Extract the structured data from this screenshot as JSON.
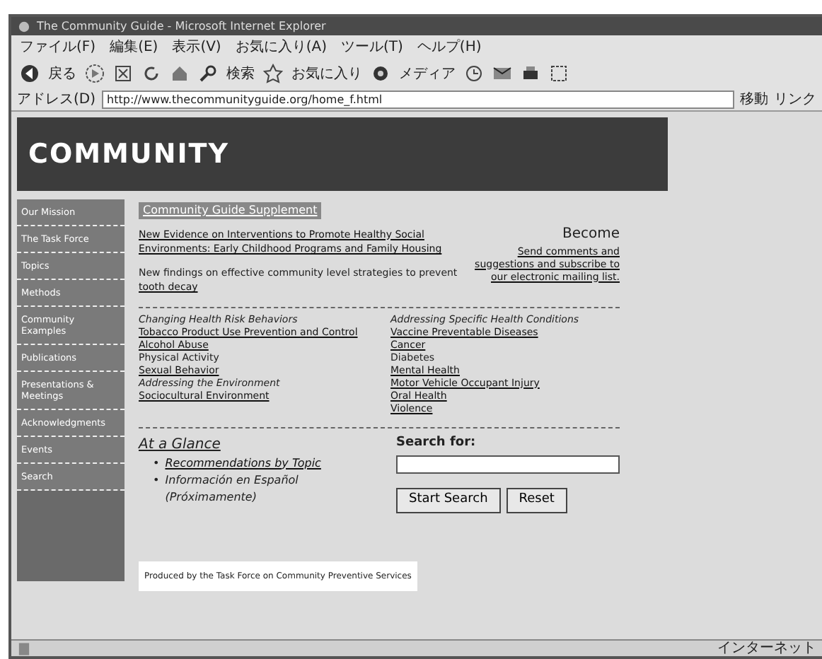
{
  "window": {
    "title": "The Community Guide - Microsoft Internet Explorer"
  },
  "menu": [
    "ファイル(F)",
    "編集(E)",
    "表示(V)",
    "お気に入り(A)",
    "ツール(T)",
    "ヘルプ(H)"
  ],
  "toolbar": [
    {
      "kind": "back",
      "label": "戻る"
    },
    {
      "kind": "forward"
    },
    {
      "kind": "stop"
    },
    {
      "kind": "refresh"
    },
    {
      "kind": "home"
    },
    {
      "kind": "search",
      "label": "検索"
    },
    {
      "kind": "favorites",
      "label": "お気に入り"
    },
    {
      "kind": "media",
      "label": "メディア"
    },
    {
      "kind": "history"
    },
    {
      "kind": "mail"
    },
    {
      "kind": "print"
    },
    {
      "kind": "edit"
    }
  ],
  "address": {
    "label": "アドレス(D)",
    "url": "http://www.thecommunityguide.org/home_f.html",
    "go": "移動",
    "links": "リンク"
  },
  "banner": {
    "title": "COMMUNITY"
  },
  "sidebar": {
    "items": [
      "Our Mission",
      "The Task Force",
      "Topics",
      "Methods",
      "Community Examples",
      "Publications",
      "Presentations & Meetings",
      "Acknowledgments",
      "Events",
      "Search"
    ]
  },
  "main": {
    "heading": "Community Guide Supplement",
    "news": [
      {
        "text": "New Evidence on Interventions to Promote Healthy Social Environments: Early Childhood Programs and Family Housing",
        "link": true
      },
      {
        "text": "New findings on effective community level strategies to prevent",
        "link": false
      },
      {
        "text": "tooth decay",
        "link": true
      }
    ],
    "become": {
      "title": "Become",
      "link": "Send comments and suggestions and subscribe to our electronic mailing list."
    },
    "columns": [
      {
        "title": "Changing Health Risk Behaviors",
        "items": [
          {
            "text": "Tobacco Product Use Prevention and Control",
            "link": true
          },
          {
            "text": "Alcohol Abuse",
            "link": true
          },
          {
            "text": "Physical Activity",
            "link": false
          },
          {
            "text": "Sexual Behavior",
            "link": true
          },
          {
            "text": "Addressing the Environment",
            "link": false,
            "italic": true
          },
          {
            "text": "Sociocultural Environment",
            "link": true
          }
        ]
      },
      {
        "title": "Addressing Specific Health Conditions",
        "items": [
          {
            "text": "Vaccine Preventable Diseases",
            "link": true
          },
          {
            "text": "Cancer",
            "link": true
          },
          {
            "text": "Diabetes",
            "link": false
          },
          {
            "text": "Mental Health",
            "link": true
          },
          {
            "text": "Motor Vehicle Occupant Injury",
            "link": true
          },
          {
            "text": "Oral Health",
            "link": true
          },
          {
            "text": "Violence",
            "link": true
          }
        ]
      }
    ],
    "glance": {
      "title": "At a Glance",
      "items": [
        {
          "marker": "•",
          "text": "Recommendations by Topic",
          "link": true
        },
        {
          "marker": "•",
          "text": "Información en Español (Próximamente)",
          "link": false
        }
      ]
    },
    "search": {
      "label": "Search for:",
      "buttons": [
        "Start Search",
        "Reset"
      ]
    },
    "footer": "Produced by the Task Force on Community Preventive Services"
  },
  "status_bar": {
    "zone": "インターネット"
  }
}
